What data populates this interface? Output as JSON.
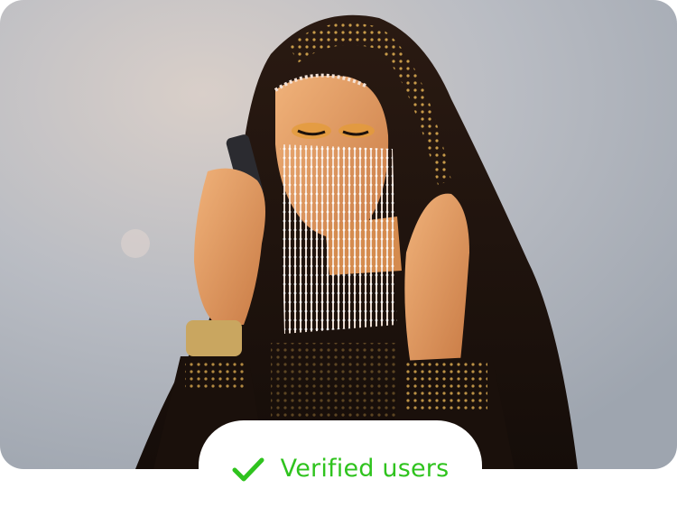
{
  "badge": {
    "label": "Verified users",
    "icon": "check-icon",
    "color": "#2fc31e"
  },
  "photo": {
    "icon": "veiled-woman-photo"
  }
}
